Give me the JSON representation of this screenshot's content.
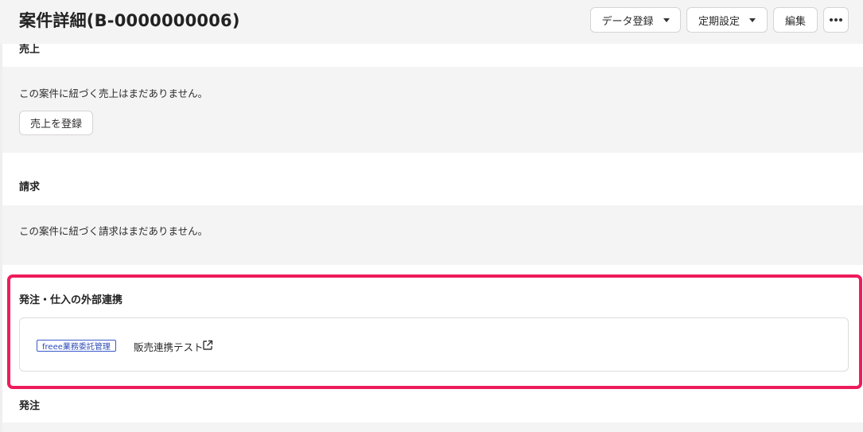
{
  "header": {
    "title": "案件詳細(B-0000000006)",
    "data_register_label": "データ登録",
    "schedule_label": "定期設定",
    "edit_label": "編集",
    "more_icon": "more-horizontal-icon"
  },
  "sales": {
    "heading": "売上",
    "empty_message": "この案件に紐づく売上はまだありません。",
    "register_button": "売上を登録"
  },
  "billing": {
    "heading": "請求",
    "empty_message": "この案件に紐づく請求はまだありません。"
  },
  "external": {
    "heading": "発注・仕入の外部連携",
    "service_tag": "freee業務委託管理",
    "link_label": "販売連携テスト",
    "link_icon": "external-link-icon",
    "highlight_color": "#ee1b5b"
  },
  "order": {
    "heading": "発注"
  }
}
